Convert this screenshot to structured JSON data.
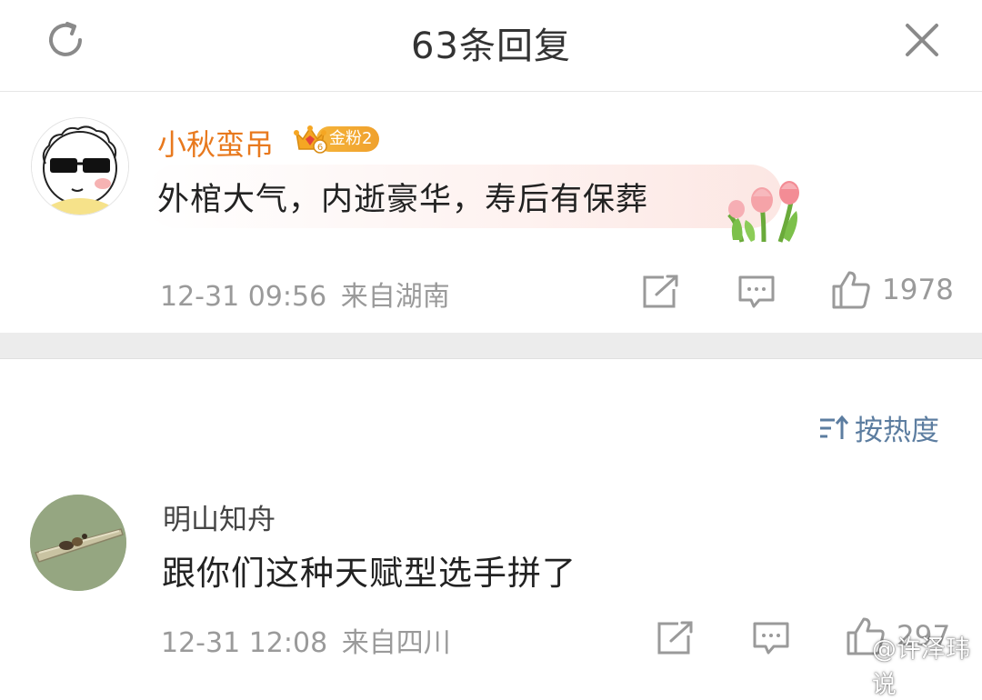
{
  "header": {
    "title": "63条回复",
    "refresh_icon": "refresh-icon",
    "close_icon": "close-icon"
  },
  "main_comment": {
    "username": "小秋蛮吊",
    "badge_text": "金粉2",
    "badge_level": "6",
    "text": "外棺大气，内逝豪华，寿后有保葬",
    "timestamp": "12-31 09:56",
    "location": "来自湖南",
    "likes": "1978",
    "username_color": "#e8791e"
  },
  "sort": {
    "label": "按热度",
    "color": "#5c7da0"
  },
  "replies": [
    {
      "username": "明山知舟",
      "text": "跟你们这种天赋型选手拼了",
      "timestamp": "12-31 12:08",
      "location": "来自四川",
      "likes": "297"
    }
  ],
  "watermark": {
    "text": "@许泽玮说"
  }
}
